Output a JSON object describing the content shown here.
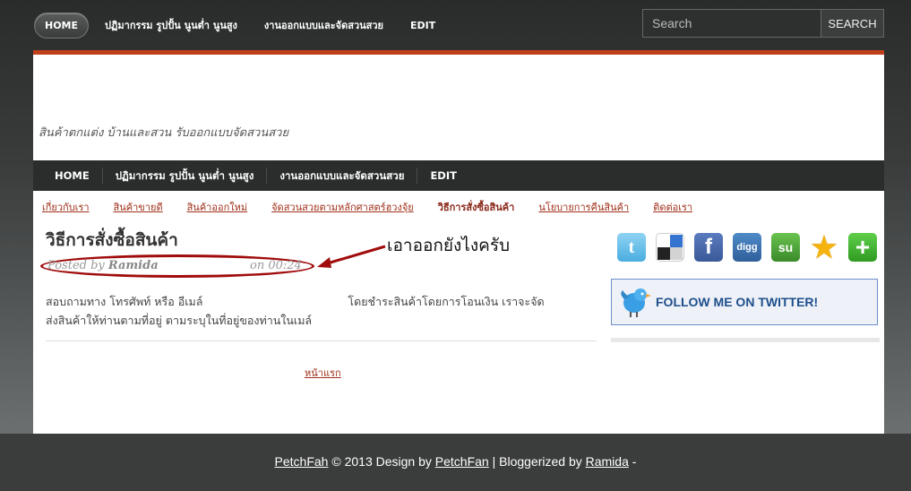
{
  "top_nav": {
    "items": [
      "HOME",
      "ปฏิมากรรม รูปปั้น นูนต่ำ นูนสูง",
      "งานออกแบบและจัดสวนสวย",
      "EDIT"
    ]
  },
  "search": {
    "placeholder": "Search",
    "button": "SEARCH"
  },
  "header": {
    "tagline": "สินค้าตกแต่ง บ้านและสวน รับออกแบบจัดสวนสวย"
  },
  "main_nav": {
    "items": [
      "HOME",
      "ปฏิมากรรม รูปปั้น นูนต่ำ นูนสูง",
      "งานออกแบบและจัดสวนสวย",
      "EDIT"
    ]
  },
  "sub_nav": {
    "items": [
      "เกี่ยวกับเรา",
      "สินค้าขายดี",
      "สินค้าออกใหม่",
      "จัดสวนสวยตามหลักศาสตร์ฮวงจุ้ย",
      "วิธีการสั่งซื้อสินค้า",
      "นโยบายการคืนสินค้า",
      "ติดต่อเรา"
    ],
    "active_index": 4
  },
  "post": {
    "title": "วิธีการสั่งซื้อสินค้า",
    "posted_by_label": "Posted by",
    "author": "Ramida",
    "time": "on 00:24",
    "body_part1": "สอบถามทาง  โทรศัพท์ หรือ อีเมล์",
    "body_part2": "โดยชำระสินค้าโดยการโอนเงิน  เราจะจัด",
    "body_line2": "ส่งสินค้าให้ท่านตามที่อยู่ ตามระบุในที่อยู่ของท่านในเมล์",
    "home_link": "หน้าแรก"
  },
  "annotation": {
    "text": "เอาออกยังไงครับ",
    "color": "#a00c0c"
  },
  "sidebar": {
    "social_icons": [
      {
        "name": "twitter-icon",
        "glyph": "t",
        "color": "#5ab8e6"
      },
      {
        "name": "delicious-icon",
        "glyph": "",
        "color": "#ffffff"
      },
      {
        "name": "facebook-icon",
        "glyph": "f",
        "color": "#3b5998"
      },
      {
        "name": "digg-icon",
        "glyph": "digg",
        "color": "#3a6ea5"
      },
      {
        "name": "stumbleupon-icon",
        "glyph": "su",
        "color": "#4d9b3a"
      },
      {
        "name": "favorite-star-icon",
        "glyph": "★",
        "color": "#f5b30e"
      },
      {
        "name": "add-plus-icon",
        "glyph": "+",
        "color": "#3fa532"
      }
    ],
    "follow_text": "FOLLOW ME ON TWITTER!"
  },
  "footer": {
    "brand": "PetchFah",
    "copyright": " © 2013 Design by ",
    "designer": "PetchFan",
    "bloggerized": " | Bloggerized by ",
    "author": "Ramida",
    "dash": " -"
  },
  "colors": {
    "accent_red": "#c0401c",
    "link": "#a0301a",
    "nav_bg": "#2b2d2d"
  }
}
